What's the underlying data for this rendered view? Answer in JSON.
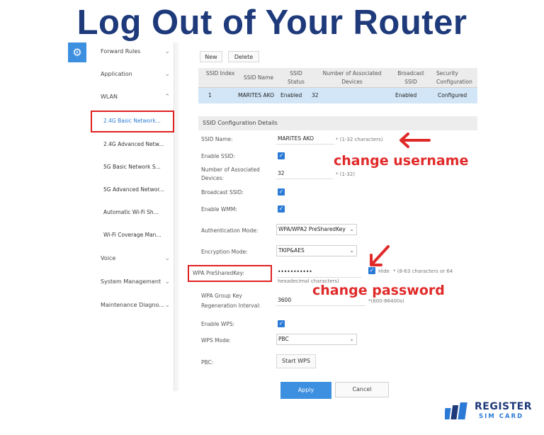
{
  "title": "Log Out of Your Router",
  "sidebar": {
    "items": [
      {
        "label": "Forward Rules"
      },
      {
        "label": "Application"
      },
      {
        "label": "WLAN"
      }
    ],
    "sub_items": [
      {
        "label": "2.4G Basic Network..."
      },
      {
        "label": "2.4G Advanced Netw..."
      },
      {
        "label": "5G Basic Network S..."
      },
      {
        "label": "5G Advanced Networ..."
      },
      {
        "label": "Automatic Wi-Fi Sh..."
      },
      {
        "label": "Wi-Fi Coverage Man..."
      }
    ],
    "bottom_items": [
      {
        "label": "Voice"
      },
      {
        "label": "System Management"
      },
      {
        "label": "Maintenance Diagno..."
      }
    ]
  },
  "toolbar": {
    "new_label": "New",
    "delete_label": "Delete"
  },
  "table": {
    "headers": [
      "SSID Index",
      "SSID Name",
      "SSID Status",
      "Number of Associated Devices",
      "Broadcast SSID",
      "Security Configuration"
    ],
    "row": [
      "1",
      "MARITES AKO",
      "Enabled",
      "32",
      "Enabled",
      "Configured"
    ]
  },
  "section_title": "SSID Configuration Details",
  "fields": {
    "ssid_name_label": "SSID Name:",
    "ssid_name_value": "MARITES AKO",
    "ssid_name_hint": "* (1-32 characters)",
    "enable_ssid_label": "Enable SSID:",
    "assoc_label_1": "Number of Associated",
    "assoc_label_2": "Devices:",
    "assoc_value": "32",
    "assoc_hint": "* (1-32)",
    "broadcast_label": "Broadcast SSID:",
    "wmm_label": "Enable WMM:",
    "auth_label": "Authentication Mode:",
    "auth_value": "WPA/WPA2 PreSharedKey",
    "enc_label": "Encryption Mode:",
    "enc_value": "TKIP&AES",
    "wpa_label": "WPA PreSharedKey:",
    "wpa_value": "•••••••••••",
    "hide_label": "Hide",
    "wpa_hint_1": "* (8-63 characters or 64",
    "wpa_hint_2": "hexadecimal characters)",
    "group_key_label_1": "WPA Group Key",
    "group_key_label_2": "Regeneration Interval:",
    "group_key_value": "3600",
    "group_key_hint": "*(600-86400s)",
    "wps_label": "Enable WPS:",
    "wps_mode_label": "WPS Mode:",
    "wps_mode_value": "PBC",
    "pbc_label": "PBC:",
    "start_wps_label": "Start WPS"
  },
  "actions": {
    "apply_label": "Apply",
    "cancel_label": "Cancel"
  },
  "annotations": {
    "change_username": "change username",
    "change_password": "change password"
  },
  "logo": {
    "line1": "REGISTER",
    "line2": "SIM CARD"
  },
  "colors": {
    "title": "#1e3a7b",
    "accent": "#3d8fe0",
    "annotation": "#e02a2a",
    "row_highlight": "#d2e6f7"
  }
}
